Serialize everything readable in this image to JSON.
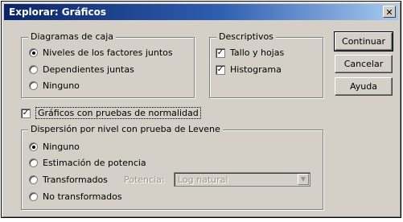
{
  "window": {
    "title": "Explorar: Gráficos",
    "close_glyph": "✕"
  },
  "boxplots": {
    "label": "Diagramas de caja",
    "options": [
      {
        "label": "Niveles de los factores juntos",
        "selected": true
      },
      {
        "label": "Dependientes juntas",
        "selected": false
      },
      {
        "label": "Ninguno",
        "selected": false
      }
    ]
  },
  "descriptives": {
    "label": "Descriptivos",
    "options": [
      {
        "label": "Tallo y hojas",
        "checked": true
      },
      {
        "label": "Histograma",
        "checked": true
      }
    ]
  },
  "normality": {
    "label": "Gráficos con pruebas de normalidad",
    "checked": true
  },
  "levene": {
    "label": "Dispersión por nivel con prueba de Levene",
    "options": [
      {
        "label": "Ninguno",
        "selected": true
      },
      {
        "label": "Estimación de potencia",
        "selected": false
      },
      {
        "label": "Transformados",
        "selected": false
      },
      {
        "label": "No transformados",
        "selected": false
      }
    ],
    "power_label": "Potencia:",
    "power_value": "Log natural"
  },
  "buttons": {
    "continue": "Continuar",
    "cancel": "Cancelar",
    "help": "Ayuda"
  }
}
